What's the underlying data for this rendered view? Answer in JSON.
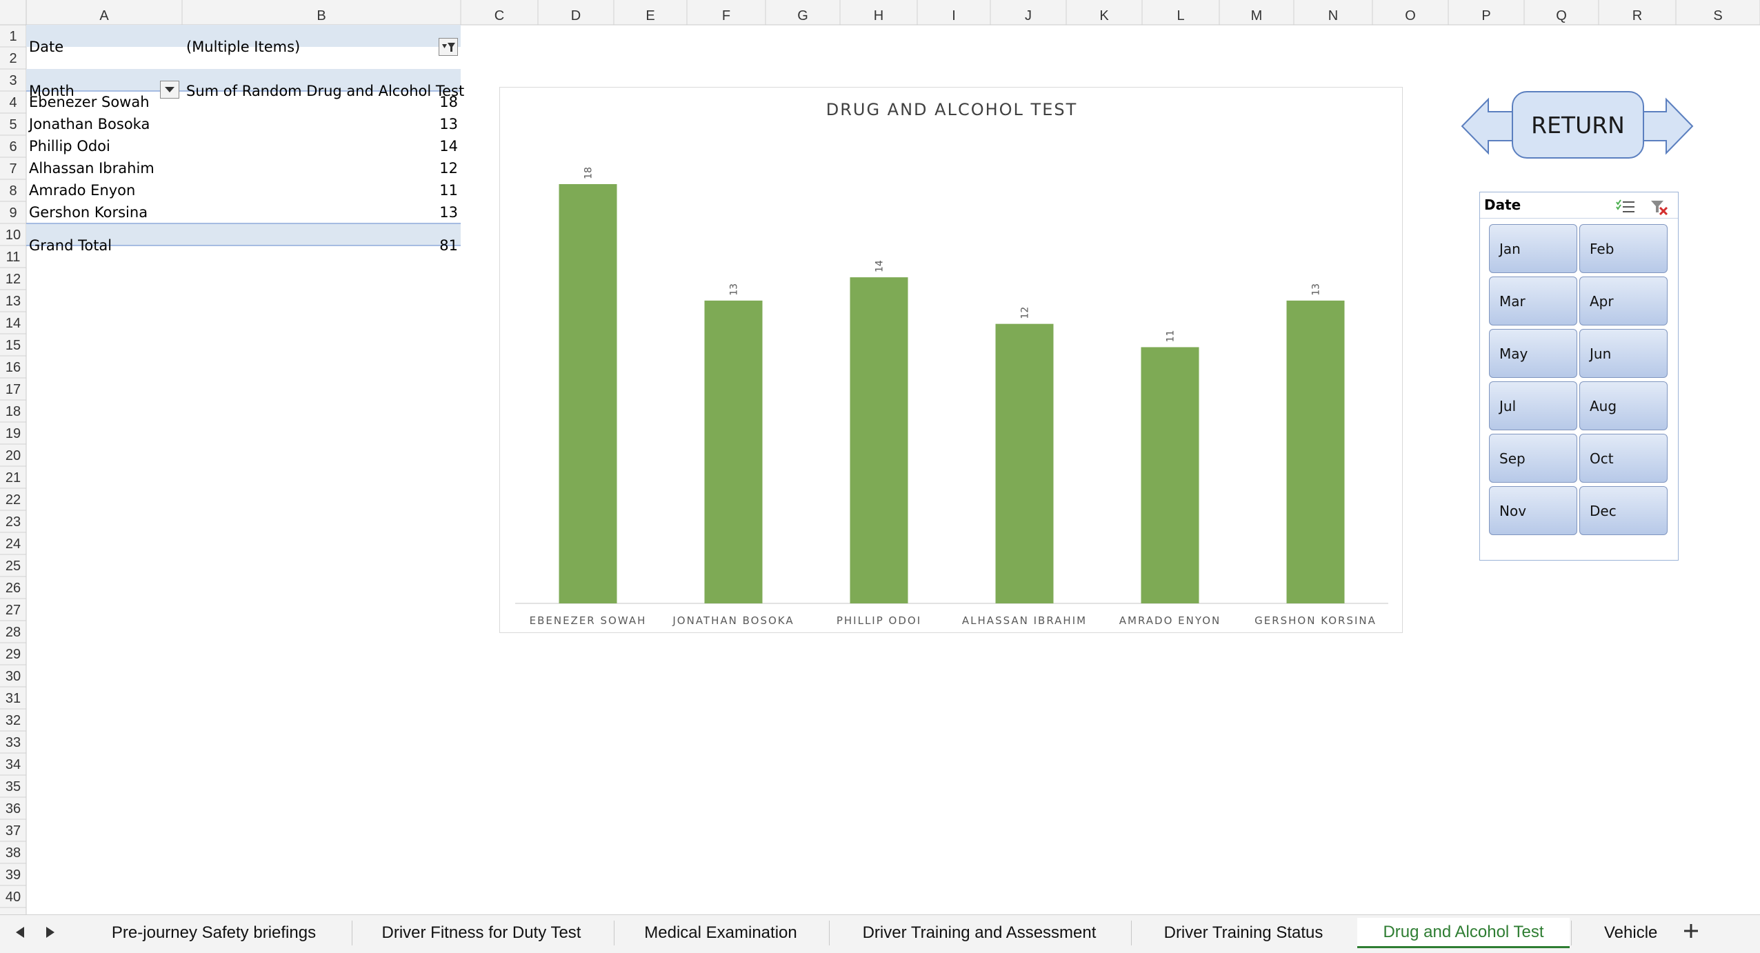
{
  "columns": [
    "A",
    "B",
    "C",
    "D",
    "E",
    "F",
    "G",
    "H",
    "I",
    "J",
    "K",
    "L",
    "M",
    "N",
    "O",
    "P",
    "Q",
    "R",
    "S"
  ],
  "rows": [
    "1",
    "2",
    "3",
    "4",
    "5",
    "6",
    "7",
    "8",
    "9",
    "10",
    "11",
    "12",
    "13",
    "14",
    "15",
    "16",
    "17",
    "18",
    "19",
    "20",
    "21",
    "22",
    "23",
    "24",
    "25",
    "26",
    "27",
    "28",
    "29",
    "30",
    "31",
    "32",
    "33",
    "34",
    "35",
    "36",
    "37",
    "38",
    "39",
    "40"
  ],
  "pivot": {
    "filter_label": "Date",
    "filter_value": "(Multiple Items)",
    "row_header": "Month",
    "value_header": "Sum of  Random Drug and Alcohol Test",
    "items": [
      {
        "name": "Ebenezer Sowah",
        "value": "18"
      },
      {
        "name": "Jonathan Bosoka",
        "value": "13"
      },
      {
        "name": "Phillip Odoi",
        "value": "14"
      },
      {
        "name": "Alhassan Ibrahim",
        "value": "12"
      },
      {
        "name": "Amrado Enyon",
        "value": "11"
      },
      {
        "name": "Gershon Korsina",
        "value": "13"
      }
    ],
    "total_label": "Grand Total",
    "total_value": "81"
  },
  "colors": {
    "bar": "#7eaa55",
    "header_fill": "#dce6f1",
    "active_tab": "#2e7d32",
    "grid": "#e1e1e1"
  },
  "chart_data": {
    "type": "bar",
    "title": "DRUG AND ALCOHOL TEST",
    "categories": [
      "EBENEZER SOWAH",
      "JONATHAN BOSOKA",
      "PHILLIP ODOI",
      "ALHASSAN IBRAHIM",
      "AMRADO ENYON",
      "GERSHON KORSINA"
    ],
    "values": [
      18,
      13,
      14,
      12,
      11,
      13
    ],
    "data_labels": [
      "18",
      "13",
      "14",
      "12",
      "11",
      "13"
    ],
    "xlabel": "",
    "ylabel": "",
    "ylim": [
      0,
      18
    ],
    "grid": false,
    "legend": "none"
  },
  "return_button": {
    "label": "RETURN",
    "icons": [
      "arrow-left-icon",
      "arrow-right-icon"
    ]
  },
  "slicer": {
    "title": "Date",
    "icons": [
      "multi-select-icon",
      "clear-filter-icon"
    ],
    "items": [
      "Jan",
      "Feb",
      "Mar",
      "Apr",
      "May",
      "Jun",
      "Jul",
      "Aug",
      "Sep",
      "Oct",
      "Nov",
      "Dec"
    ]
  },
  "tabs": [
    {
      "label": "Pre-journey Safety briefings",
      "active": false
    },
    {
      "label": "Driver Fitness for Duty Test",
      "active": false
    },
    {
      "label": "Medical Examination",
      "active": false
    },
    {
      "label": "Driver Training and Assessment",
      "active": false
    },
    {
      "label": "Driver Training Status",
      "active": false
    },
    {
      "label": "Drug and Alcohol Test",
      "active": true
    },
    {
      "label": "Vehicle",
      "active": false
    }
  ],
  "tab_nav": {
    "prev_icon": "triangle-left-icon",
    "next_icon": "triangle-right-icon",
    "add_icon": "plus-icon"
  }
}
